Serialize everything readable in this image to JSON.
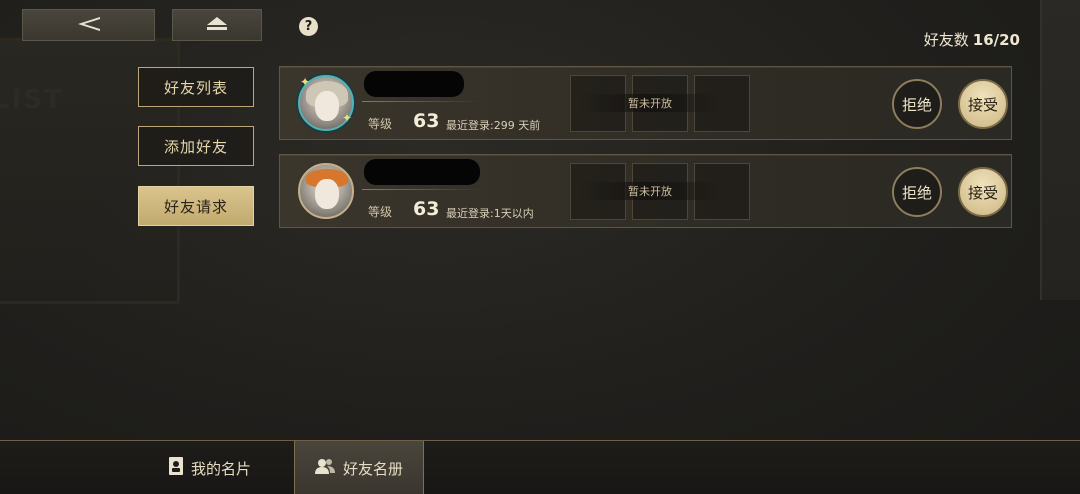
{
  "header": {
    "back_icon": "back-arrow-icon",
    "home_icon": "eject-icon",
    "help_label": "?",
    "friend_count_label": "好友数",
    "friend_count_value": "16/20"
  },
  "background": {
    "panel_text": "LIST"
  },
  "side_tabs": [
    {
      "label": "好友列表",
      "active": false
    },
    {
      "label": "添加好友",
      "active": false
    },
    {
      "label": "好友请求",
      "active": true
    }
  ],
  "requests": [
    {
      "level_label": "等级",
      "level": "63",
      "last_login": "最近登录:299 天前",
      "slot_status": "暂未开放",
      "reject_label": "拒绝",
      "accept_label": "接受"
    },
    {
      "level_label": "等级",
      "level": "63",
      "last_login": "最近登录:1天以内",
      "slot_status": "暂未开放",
      "reject_label": "拒绝",
      "accept_label": "接受"
    }
  ],
  "bottom_tabs": [
    {
      "label": "我的名片",
      "icon": "id-card-icon",
      "active": false
    },
    {
      "label": "好友名册",
      "icon": "users-icon",
      "active": true
    }
  ]
}
